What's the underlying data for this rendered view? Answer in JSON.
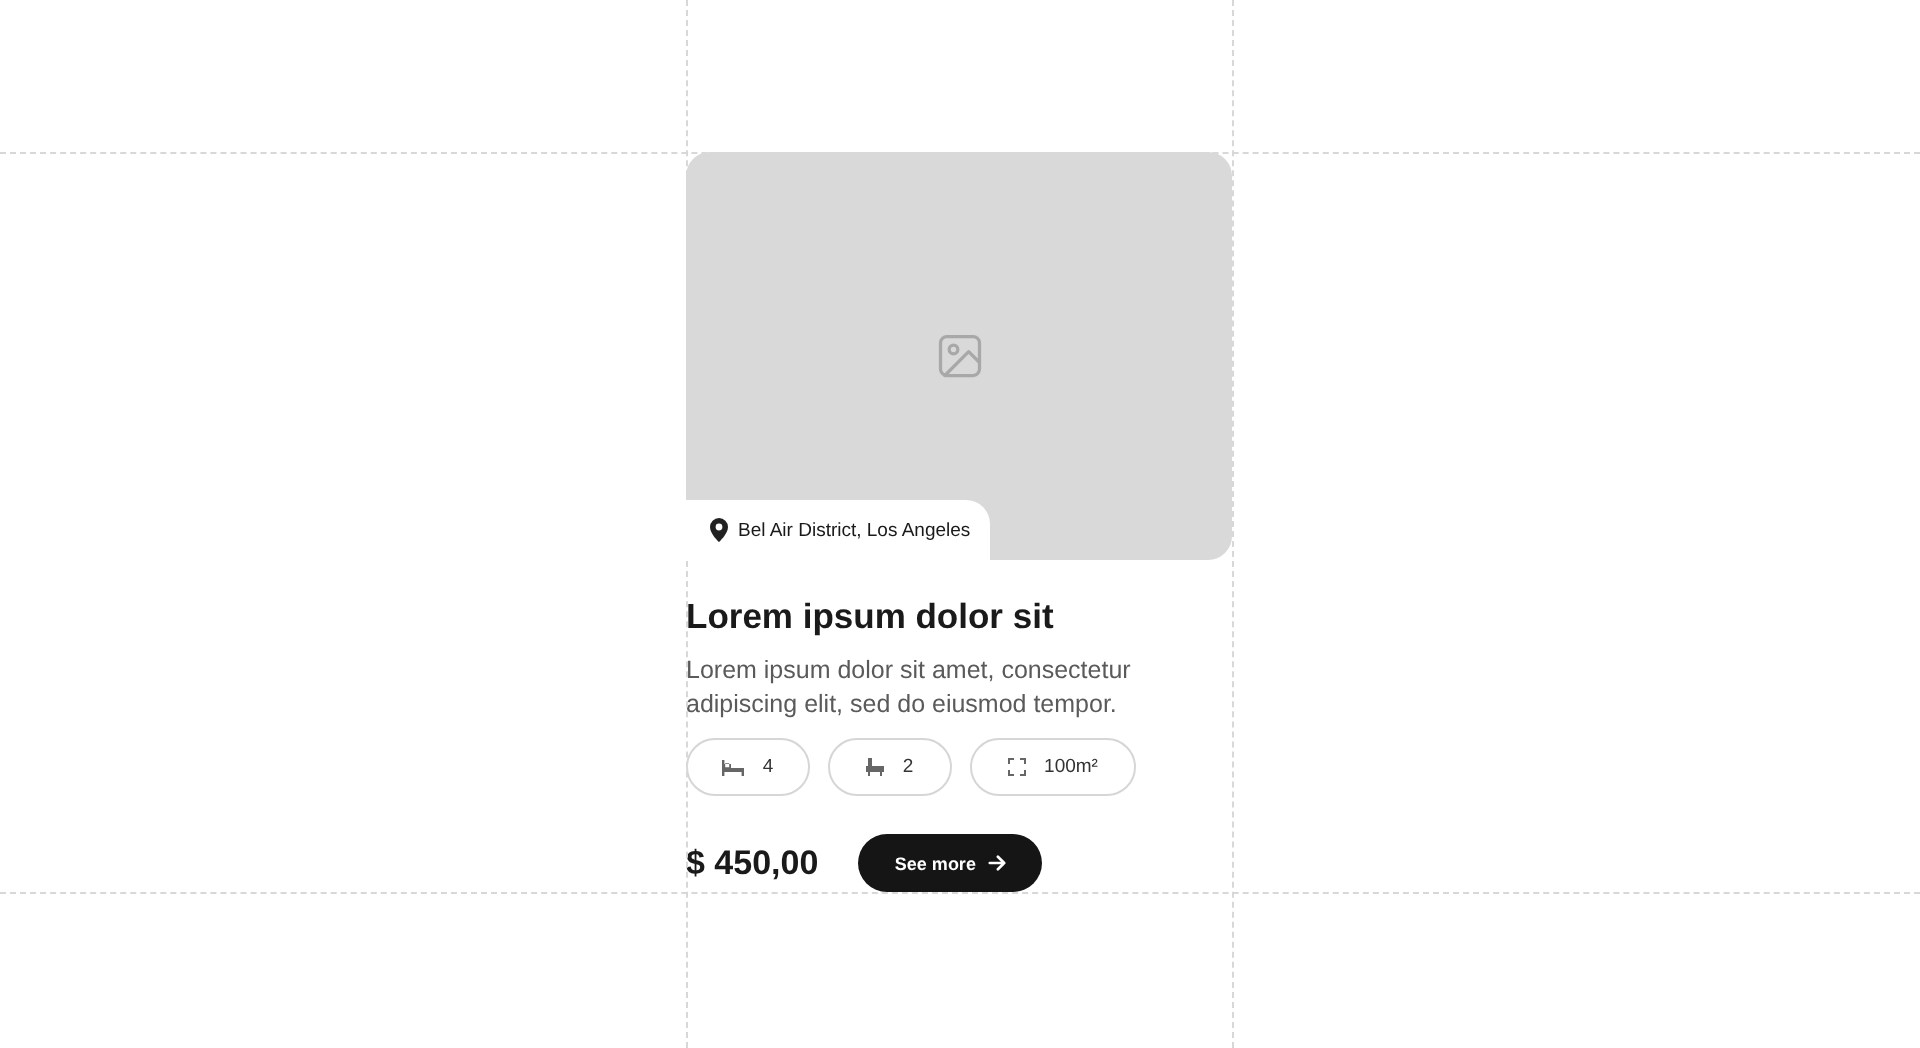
{
  "card": {
    "location": "Bel Air District, Los Angeles",
    "title": "Lorem ipsum dolor sit",
    "description": "Lorem ipsum dolor sit amet, consectetur adipiscing elit, sed do eiusmod tempor.",
    "features": [
      {
        "kind": "bed",
        "value": "4"
      },
      {
        "kind": "bath",
        "value": "2"
      },
      {
        "kind": "area",
        "value": "100m²"
      }
    ],
    "price": "$ 450,00",
    "button": "See more"
  }
}
